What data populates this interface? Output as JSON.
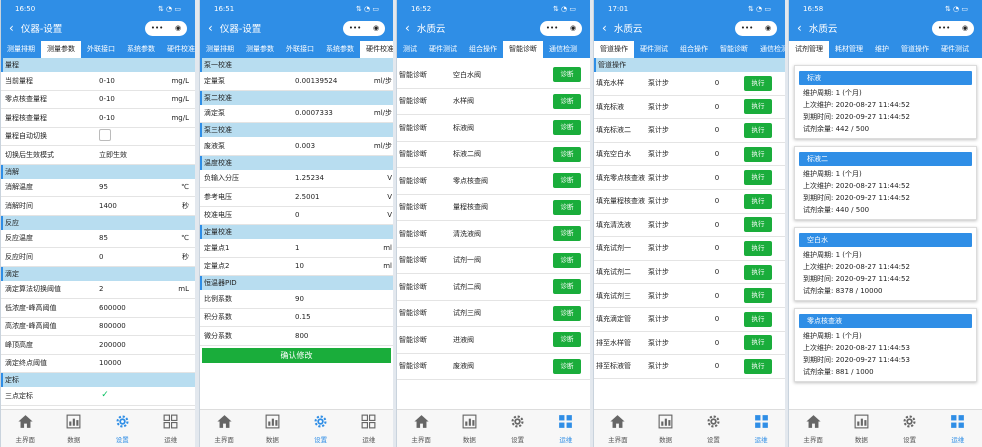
{
  "nav_labels": [
    "主界面",
    "数据",
    "设置",
    "运维"
  ],
  "colors": {
    "accent": "#2f8ee6",
    "green": "#1aad3b",
    "section_bg": "#b8ddf0"
  },
  "icons": {
    "back": "back-arrow-icon",
    "more": "more-dots-icon",
    "target": "target-circle-icon",
    "home": "home-icon",
    "data": "bar-chart-icon",
    "settings": "gear-icon",
    "ops": "grid-icon"
  },
  "s1": {
    "time": "16:50",
    "title": "仪器-设置",
    "tabs": [
      "测量排期",
      "测量参数",
      "外联接口",
      "系统参数",
      "硬件校准"
    ],
    "sections": [
      {
        "title": "量程",
        "rows": [
          [
            "当前量程",
            "0-10",
            "mg/L"
          ],
          [
            "零点核查量程",
            "0-10",
            "mg/L"
          ],
          [
            "量程核查量程",
            "0-10",
            "mg/L"
          ],
          [
            "量程自动切换",
            "",
            ""
          ],
          [
            "切换后生效模式",
            "立即生效",
            ""
          ]
        ]
      },
      {
        "title": "消解",
        "rows": [
          [
            "消解温度",
            "95",
            "℃"
          ],
          [
            "消解时间",
            "1400",
            "秒"
          ]
        ]
      },
      {
        "title": "反应",
        "rows": [
          [
            "反应温度",
            "85",
            "℃"
          ],
          [
            "反应时间",
            "0",
            "秒"
          ]
        ]
      },
      {
        "title": "滴定",
        "rows": [
          [
            "滴定算法切换阈值",
            "2",
            "mL"
          ],
          [
            "低浓度-峰高阈值",
            "600000",
            ""
          ],
          [
            "高浓度-峰高阈值",
            "800000",
            ""
          ],
          [
            "峰顶高度",
            "200000",
            ""
          ],
          [
            "滴定终点阈值",
            "10000",
            ""
          ]
        ]
      },
      {
        "title": "定标",
        "rows": [
          [
            "三点定标",
            "",
            ""
          ]
        ]
      }
    ]
  },
  "s2": {
    "time": "16:51",
    "title": "仪器-设置",
    "tabs": [
      "测量排期",
      "测量参数",
      "外联接口",
      "系统参数",
      "硬件校准"
    ],
    "sections": [
      {
        "title": "泵一校准",
        "rows": [
          [
            "定量泵",
            "0.00139524",
            "ml/步"
          ]
        ]
      },
      {
        "title": "泵二校准",
        "rows": [
          [
            "滴定泵",
            "0.0007333",
            "ml/步"
          ]
        ]
      },
      {
        "title": "泵三校准",
        "rows": [
          [
            "废液泵",
            "0.003",
            "ml/步"
          ]
        ]
      },
      {
        "title": "温度校准",
        "rows": [
          [
            "负输入分压",
            "1.25234",
            "V"
          ],
          [
            "参考电压",
            "2.5001",
            "V"
          ],
          [
            "校准电压",
            "0",
            "V"
          ]
        ]
      },
      {
        "title": "定量校准",
        "rows": [
          [
            "定量点1",
            "1",
            "ml"
          ],
          [
            "定量点2",
            "10",
            "ml"
          ]
        ]
      },
      {
        "title": "恒温器PID",
        "rows": [
          [
            "比例系数",
            "90",
            ""
          ],
          [
            "积分系数",
            "0.15",
            ""
          ],
          [
            "微分系数",
            "800",
            ""
          ]
        ]
      }
    ],
    "confirm": "确认修改"
  },
  "s3": {
    "time": "16:52",
    "title": "水质云",
    "tabs": [
      "测试",
      "硬件测试",
      "组合操作",
      "智能诊断",
      "通信检测"
    ],
    "rows": [
      [
        "智能诊断",
        "空白水阀"
      ],
      [
        "智能诊断",
        "水样阀"
      ],
      [
        "智能诊断",
        "标液阀"
      ],
      [
        "智能诊断",
        "标液二阀"
      ],
      [
        "智能诊断",
        "零点核查阀"
      ],
      [
        "智能诊断",
        "量程核查阀"
      ],
      [
        "智能诊断",
        "清洗液阀"
      ],
      [
        "智能诊断",
        "试剂一阀"
      ],
      [
        "智能诊断",
        "试剂二阀"
      ],
      [
        "智能诊断",
        "试剂三阀"
      ],
      [
        "智能诊断",
        "进液阀"
      ],
      [
        "智能诊断",
        "废液阀"
      ]
    ],
    "btn": "诊断"
  },
  "s4": {
    "time": "17:01",
    "title": "水质云",
    "tabs": [
      "管道操作",
      "硬件测试",
      "组合操作",
      "智能诊断",
      "通信检测"
    ],
    "section": "管道操作",
    "rows": [
      [
        "填充水样",
        "泵计步",
        "0"
      ],
      [
        "填充标液",
        "泵计步",
        "0"
      ],
      [
        "填充标液二",
        "泵计步",
        "0"
      ],
      [
        "填充空白水",
        "泵计步",
        "0"
      ],
      [
        "填充零点核查液",
        "泵计步",
        "0"
      ],
      [
        "填充量程核查液",
        "泵计步",
        "0"
      ],
      [
        "填充清洗液",
        "泵计步",
        "0"
      ],
      [
        "填充试剂一",
        "泵计步",
        "0"
      ],
      [
        "填充试剂二",
        "泵计步",
        "0"
      ],
      [
        "填充试剂三",
        "泵计步",
        "0"
      ],
      [
        "填充滴定管",
        "泵计步",
        "0"
      ],
      [
        "排至水样管",
        "泵计步",
        "0"
      ],
      [
        "排至标液管",
        "泵计步",
        "0"
      ]
    ],
    "btn": "执行"
  },
  "s5": {
    "time": "16:58",
    "title": "水质云",
    "tabs": [
      "试剂管理",
      "耗材管理",
      "维护",
      "管道操作",
      "硬件测试"
    ],
    "cards": [
      {
        "name": "标液",
        "lines": [
          "维护周期: 1 (个月)",
          "上次维护: 2020-08-27 11:44:52",
          "到期时间: 2020-09-27 11:44:52",
          "试剂余量: 442 / 500"
        ]
      },
      {
        "name": "标液二",
        "lines": [
          "维护周期: 1 (个月)",
          "上次维护: 2020-08-27 11:44:52",
          "到期时间: 2020-09-27 11:44:52",
          "试剂余量: 440 / 500"
        ]
      },
      {
        "name": "空白水",
        "lines": [
          "维护周期: 1 (个月)",
          "上次维护: 2020-08-27 11:44:52",
          "到期时间: 2020-09-27 11:44:52",
          "试剂余量: 8378 / 10000"
        ]
      },
      {
        "name": "零点核查液",
        "lines": [
          "维护周期: 1 (个月)",
          "上次维护: 2020-08-27 11:44:53",
          "到期时间: 2020-09-27 11:44:53",
          "试剂余量: 881 / 1000"
        ]
      }
    ]
  }
}
